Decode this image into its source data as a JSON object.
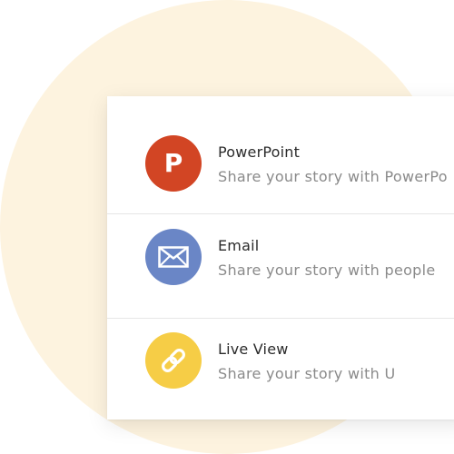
{
  "colors": {
    "background_circle": "#fdf3df",
    "powerpoint": "#d24524",
    "email": "#6a86c6",
    "live_view": "#f6cd46",
    "title_text": "#2b2b2b",
    "subtitle_text": "#8a8a8a"
  },
  "share_options": [
    {
      "icon": "powerpoint-icon",
      "icon_letter": "P",
      "title": "PowerPoint",
      "subtitle": "Share your story with PowerPo"
    },
    {
      "icon": "envelope-icon",
      "title": "Email",
      "subtitle": "Share your story with people"
    },
    {
      "icon": "link-icon",
      "title": "Live View",
      "subtitle": "Share your story with U"
    }
  ]
}
